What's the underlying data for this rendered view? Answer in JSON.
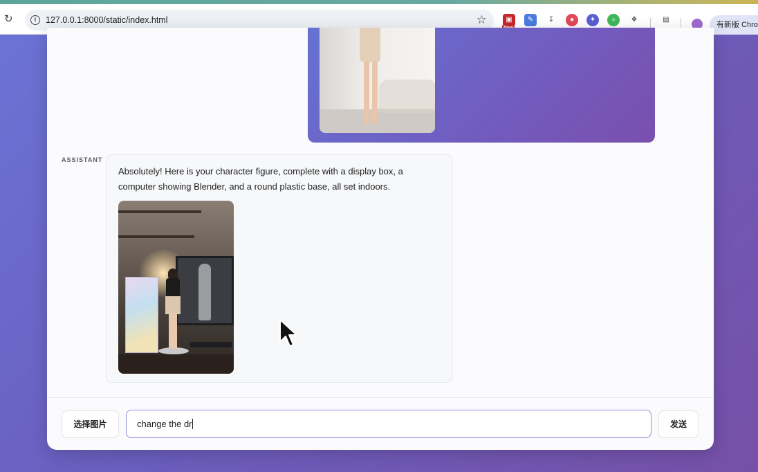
{
  "browser": {
    "url": "127.0.0.1:8000/static/index.html",
    "update_button_label": "有新版 Chro",
    "new_badge": "New"
  },
  "chat": {
    "messages": [
      {
        "role": "user",
        "has_image": true
      },
      {
        "role": "ASSISTANT",
        "text": "Absolutely! Here is your character figure, complete with a display box, a computer showing Blender, and a round plastic base, all set indoors.",
        "has_image": true
      }
    ]
  },
  "composer": {
    "choose_image_label": "选择图片",
    "input_value": "change the dr",
    "send_label": "发送"
  }
}
